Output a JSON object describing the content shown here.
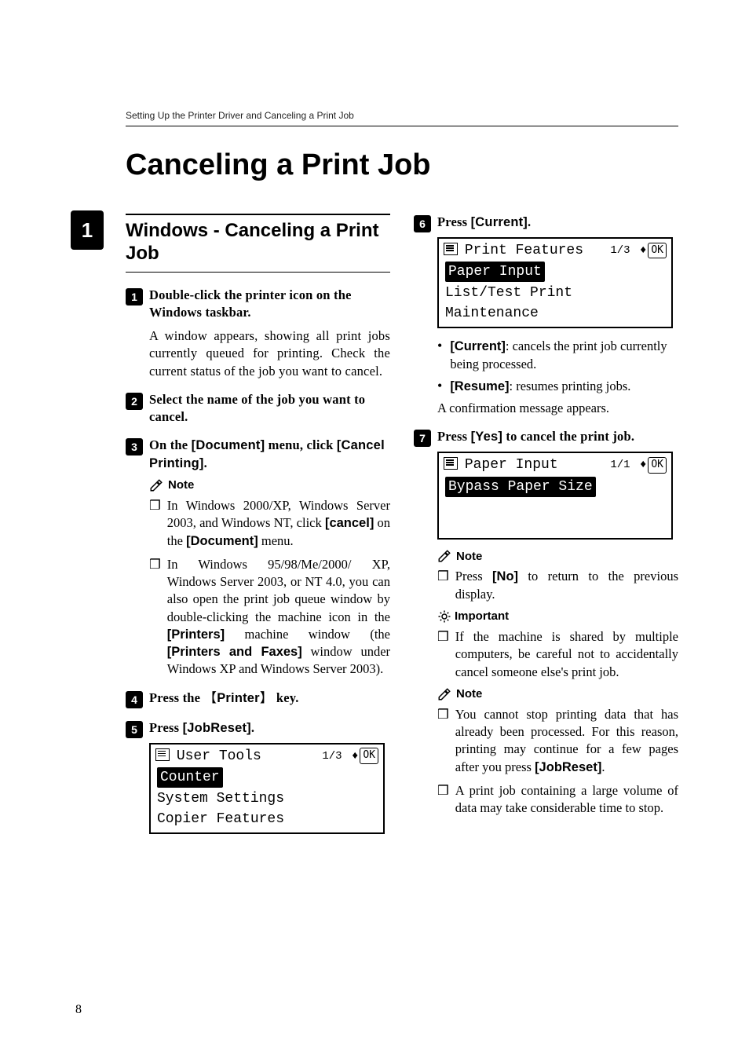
{
  "running_head": "Setting Up the Printer Driver and Canceling a Print Job",
  "side_tab": "1",
  "page_number": "8",
  "title": "Canceling a Print Job",
  "section_heading": "Windows - Canceling a Print Job",
  "note_label": "Note",
  "important_label": "Important",
  "steps": {
    "s1": {
      "num": "1",
      "head_pre": "Double-click the printer icon on the Windows taskbar.",
      "body": "A window appears, showing all print jobs currently queued for printing. Check the current status of the job you want to cancel."
    },
    "s2": {
      "num": "2",
      "head": "Select the name of the job you want to cancel."
    },
    "s3": {
      "num": "3",
      "head_pre": "On the ",
      "doc_label": "[Document]",
      "head_mid": " menu, click ",
      "cancel_printing": "[Cancel Printing]",
      "head_post": "."
    },
    "s3_note1_a": "In Windows 2000/XP, Windows Server 2003, and Windows NT, click ",
    "s3_note1_cancel": "[cancel]",
    "s3_note1_b": " on the ",
    "s3_note1_doc": "[Document]",
    "s3_note1_c": " menu.",
    "s3_note2_a": "In Windows 95/98/Me/2000/ XP, Windows Server 2003, or NT 4.0, you can also open the print job queue window by double-clicking the machine icon in the ",
    "s3_note2_printers": "[Printers]",
    "s3_note2_b": " machine window (the ",
    "s3_note2_faxes": "[Printers and Faxes]",
    "s3_note2_c": " window under Windows XP and Windows Server 2003).",
    "s4": {
      "num": "4",
      "head_pre": "Press the ",
      "key": "Printer",
      "head_post": " key."
    },
    "s5": {
      "num": "5",
      "head_pre": "Press ",
      "label": "[JobReset]",
      "head_post": "."
    },
    "s6": {
      "num": "6",
      "head_pre": "Press ",
      "label": "[Current]",
      "head_post": "."
    },
    "s6_b1_label": "[Current]",
    "s6_b1_text": ": cancels the print job currently being processed.",
    "s6_b2_label": "[Resume]",
    "s6_b2_text": ": resumes printing jobs.",
    "s6_tail": "A confirmation message appears.",
    "s7": {
      "num": "7",
      "head_pre": "Press ",
      "label": "[Yes]",
      "head_post": " to cancel the print job."
    },
    "s7_note1_a": "Press ",
    "s7_note1_no": "[No]",
    "s7_note1_b": " to return to the previous display.",
    "s7_imp": "If the machine is shared by multiple computers, be careful not to accidentally cancel someone else's print job.",
    "s7_note2_a": "You cannot stop printing data that has already been processed. For this reason, printing may continue for a few pages after you press ",
    "s7_note2_label": "[JobReset]",
    "s7_note2_b": ".",
    "s7_note3": "A print job containing a large volume of data may take considerable time to stop."
  },
  "screens": {
    "user_tools": {
      "title": "User Tools",
      "pager": "1/3",
      "rows": [
        "Counter",
        "System Settings",
        "Copier Features"
      ]
    },
    "print_features": {
      "title": "Print Features",
      "pager": "1/3",
      "rows": [
        "Paper Input",
        "List/Test Print",
        "Maintenance"
      ]
    },
    "paper_input": {
      "title": "Paper Input",
      "pager": "1/1",
      "rows": [
        "Bypass Paper Size"
      ]
    }
  },
  "bullet_glyph": "❒",
  "round_bullet": "•",
  "arrow_glyph": "♦",
  "ok_glyph": "OK"
}
